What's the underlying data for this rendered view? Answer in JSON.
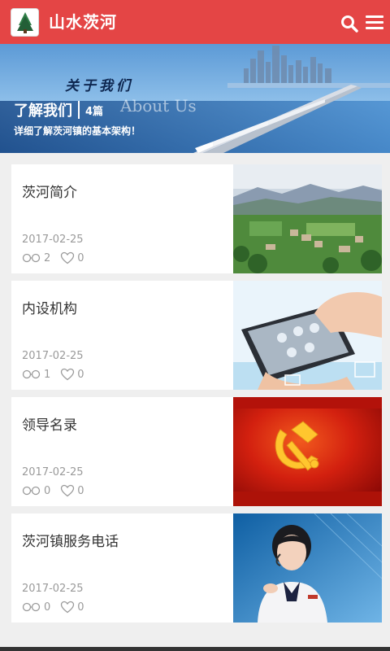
{
  "header": {
    "title": "山水茨河",
    "logo_icon": "tree-logo-icon",
    "search_icon": "search-icon",
    "menu_icon": "hamburger-menu-icon",
    "bg_color": "#e44545"
  },
  "banner": {
    "script_text": "关于我们",
    "en_text": "About Us",
    "title": "了解我们",
    "count": "4篇",
    "description": "详细了解茨河镇的基本架构！"
  },
  "articles": [
    {
      "title": "茨河简介",
      "date": "2017-02-25",
      "views": "2",
      "likes": "0"
    },
    {
      "title": "内设机构",
      "date": "2017-02-25",
      "views": "1",
      "likes": "0"
    },
    {
      "title": "领导名录",
      "date": "2017-02-25",
      "views": "0",
      "likes": "0"
    },
    {
      "title": "茨河镇服务电话",
      "date": "2017-02-25",
      "views": "0",
      "likes": "0"
    }
  ]
}
